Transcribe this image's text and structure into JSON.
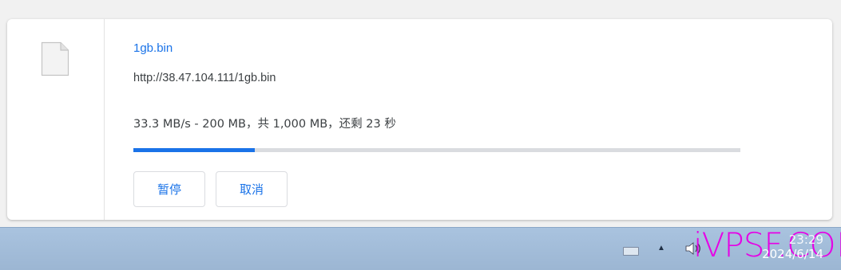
{
  "download": {
    "file_name": "1gb.bin",
    "url": "http://38.47.104.111/1gb.bin",
    "status": "33.3 MB/s - 200 MB，共 1,000 MB，还剩 23 秒",
    "progress": 0.2,
    "pause_label": "暂停",
    "cancel_label": "取消",
    "file_icon": "file-icon"
  },
  "taskbar": {
    "time": "23:29",
    "date": "2024/6/14",
    "icons": [
      "keyboard-icon",
      "show-hidden-icons-icon",
      "speaker-icon"
    ],
    "up_arrow": "▲"
  },
  "watermark": {
    "text": "iVPSF.COM",
    "color": "#e600e6"
  },
  "colors": {
    "accent": "#1a73e8",
    "progress_track": "#dadce0",
    "text": "#3c4043"
  }
}
